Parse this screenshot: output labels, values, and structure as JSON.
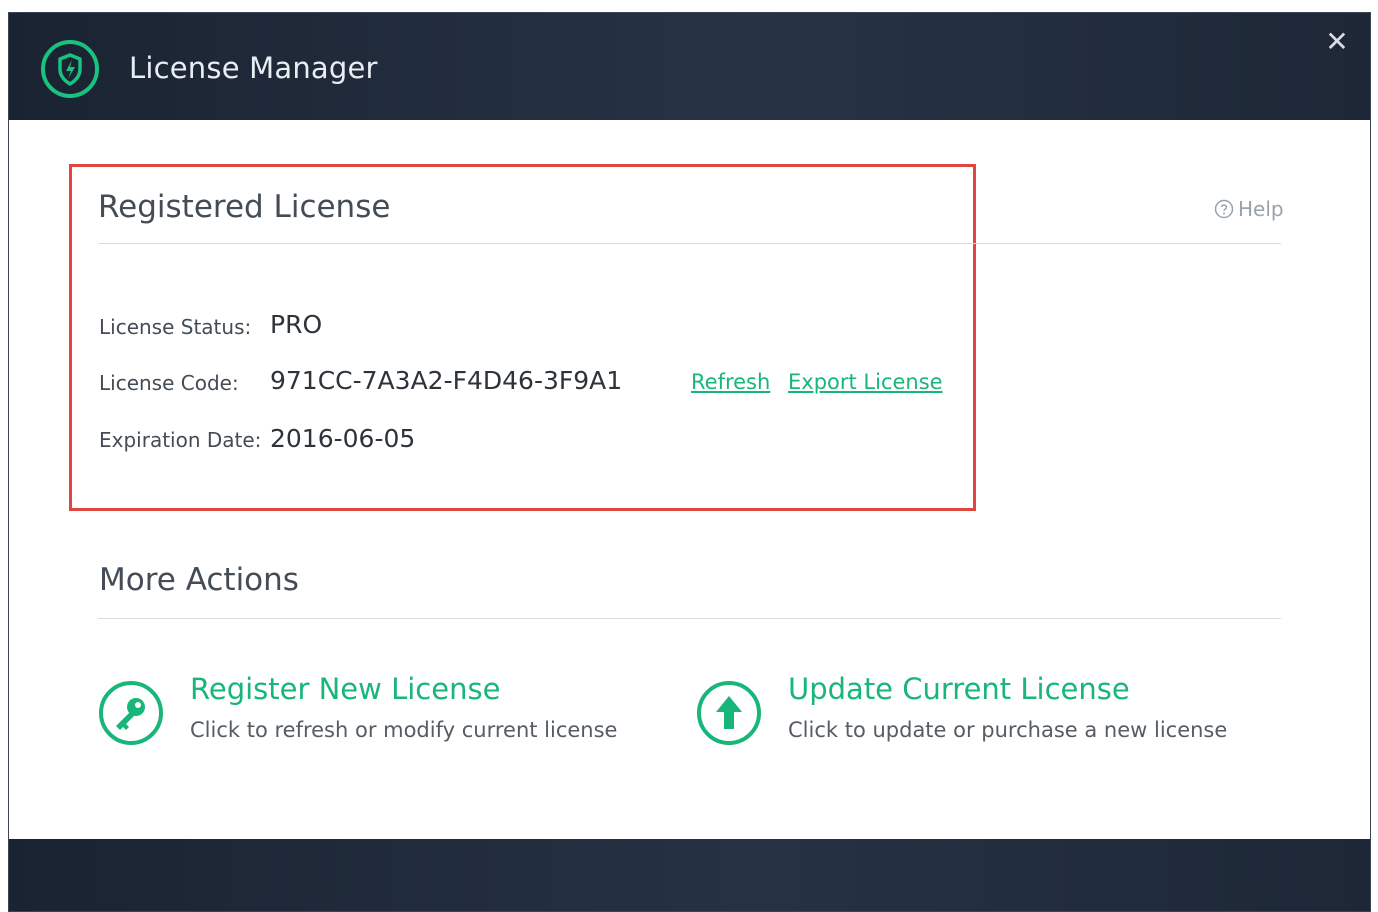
{
  "window": {
    "title": "License Manager",
    "close_label": "✕"
  },
  "registered": {
    "title": "Registered License",
    "help_label": "Help",
    "status_label": "License Status:",
    "status_value": "PRO",
    "code_label": "License Code:",
    "code_value": "971CC-7A3A2-F4D46-3F9A1",
    "refresh_label": "Refresh",
    "export_label": "Export License",
    "expiration_label": "Expiration Date:",
    "expiration_value": "2016-06-05"
  },
  "more_actions": {
    "title": "More Actions",
    "register": {
      "title": "Register New License",
      "description": "Click to refresh or modify current license",
      "icon": "key-icon"
    },
    "update": {
      "title": "Update Current License",
      "description": "Click to update or purchase a new license",
      "icon": "arrow-up-icon"
    }
  },
  "colors": {
    "accent": "#19b67a",
    "highlight": "#e0463f",
    "titlebar": "#1f2a3a"
  }
}
